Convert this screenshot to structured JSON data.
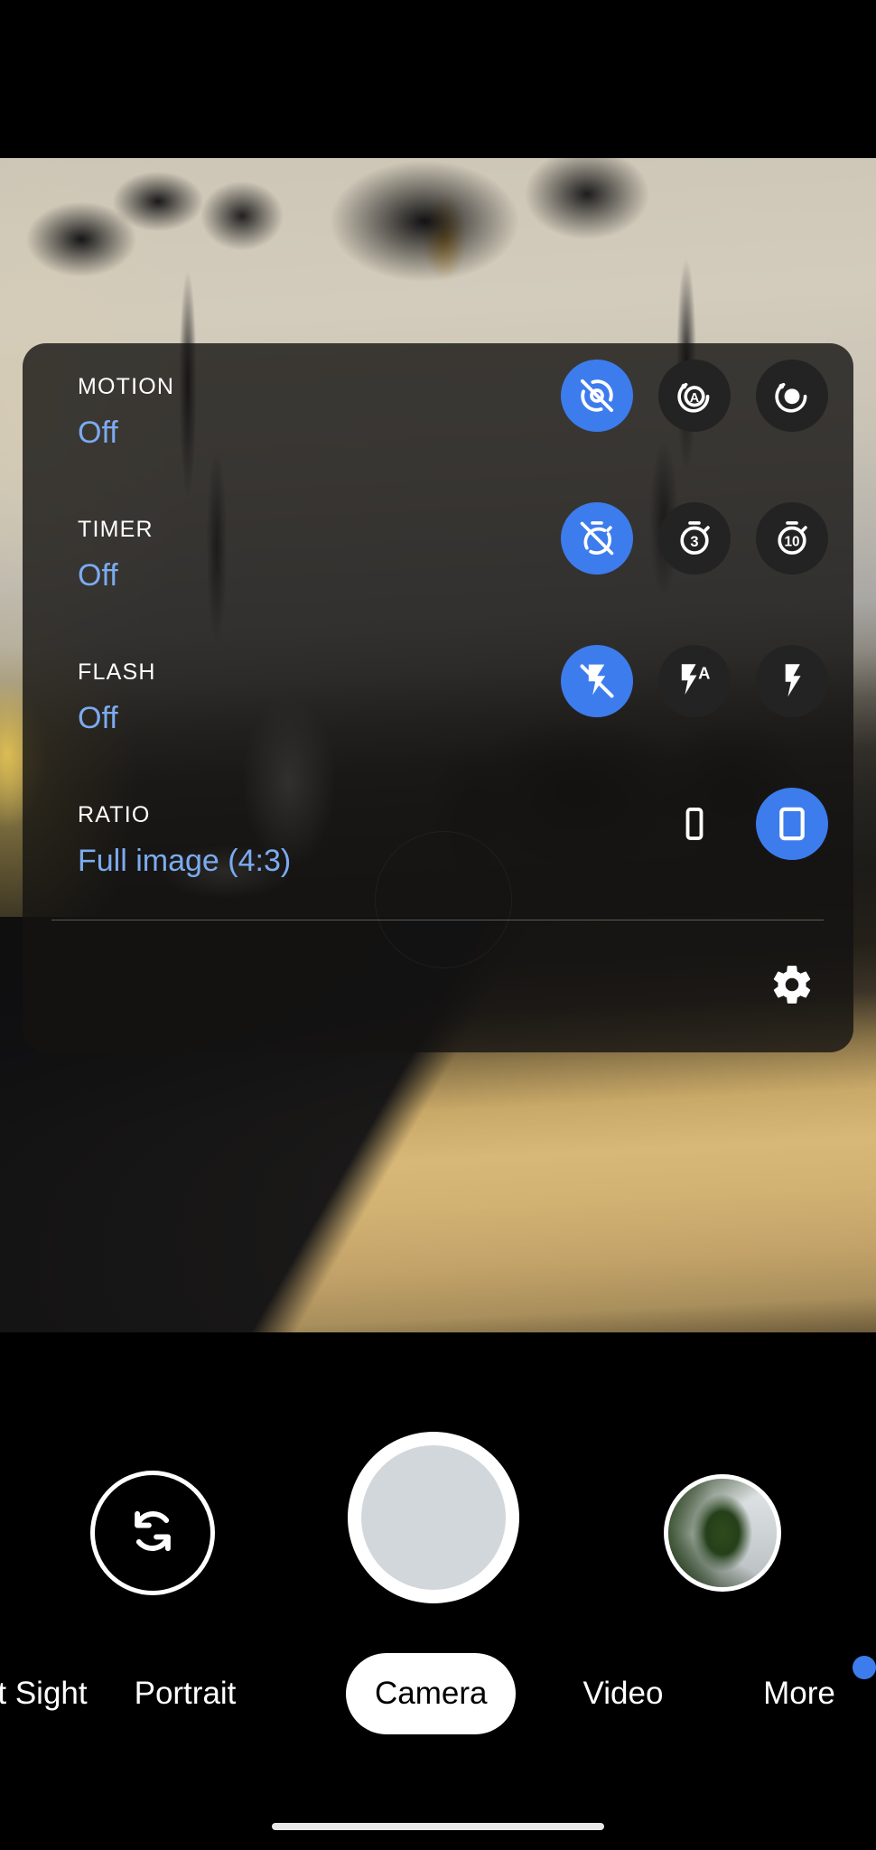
{
  "app": {
    "name": "Camera",
    "accent_blue": "#3d7ced",
    "value_text_color": "#7cabf0",
    "panel_background": "rgba(20,19,18,0.80)"
  },
  "settings_panel": {
    "rows": [
      {
        "label": "MOTION",
        "value": "Off",
        "options": [
          {
            "icon": "motion-off-icon",
            "name": "motion-off-option",
            "selected": true,
            "label": "Off"
          },
          {
            "icon": "motion-auto-icon",
            "name": "motion-auto-option",
            "selected": false,
            "label": "Auto"
          },
          {
            "icon": "motion-on-icon",
            "name": "motion-on-option",
            "selected": false,
            "label": "On"
          }
        ]
      },
      {
        "label": "TIMER",
        "value": "Off",
        "options": [
          {
            "icon": "timer-off-icon",
            "name": "timer-off-option",
            "selected": true,
            "label": "Off"
          },
          {
            "icon": "timer-3s-icon",
            "name": "timer-3s-option",
            "selected": false,
            "label": "3"
          },
          {
            "icon": "timer-10s-icon",
            "name": "timer-10s-option",
            "selected": false,
            "label": "10"
          }
        ]
      },
      {
        "label": "FLASH",
        "value": "Off",
        "options": [
          {
            "icon": "flash-off-icon",
            "name": "flash-off-option",
            "selected": true,
            "label": "Off"
          },
          {
            "icon": "flash-auto-icon",
            "name": "flash-auto-option",
            "selected": false,
            "label": "Auto"
          },
          {
            "icon": "flash-on-icon",
            "name": "flash-on-option",
            "selected": false,
            "label": "On"
          }
        ]
      },
      {
        "label": "RATIO",
        "value": "Full image (4:3)",
        "options": [
          {
            "icon": "ratio-16-9-icon",
            "name": "ratio-16-9-option",
            "selected": false,
            "label": "16:9"
          },
          {
            "icon": "ratio-4-3-icon",
            "name": "ratio-4-3-option",
            "selected": true,
            "label": "4:3"
          }
        ]
      }
    ],
    "more_settings": {
      "icon": "gear-icon",
      "name": "more-settings-button"
    }
  },
  "capture_controls": {
    "flip_camera": {
      "icon": "camera-flip-icon",
      "name": "flip-camera-button"
    },
    "shutter": {
      "icon": "shutter-icon",
      "name": "shutter-button"
    },
    "gallery_thumbnail": {
      "icon": "gallery-thumbnail",
      "name": "gallery-thumbnail-button"
    }
  },
  "mode_tabs": {
    "items": [
      {
        "label": "t Sight",
        "name": "tab-night-sight",
        "active": false
      },
      {
        "label": "Portrait",
        "name": "tab-portrait",
        "active": false
      },
      {
        "label": "Camera",
        "name": "tab-camera",
        "active": true
      },
      {
        "label": "Video",
        "name": "tab-video",
        "active": false
      },
      {
        "label": "More",
        "name": "tab-more",
        "active": false,
        "badge": true
      }
    ]
  },
  "system": {
    "home_indicator": "home-indicator"
  }
}
